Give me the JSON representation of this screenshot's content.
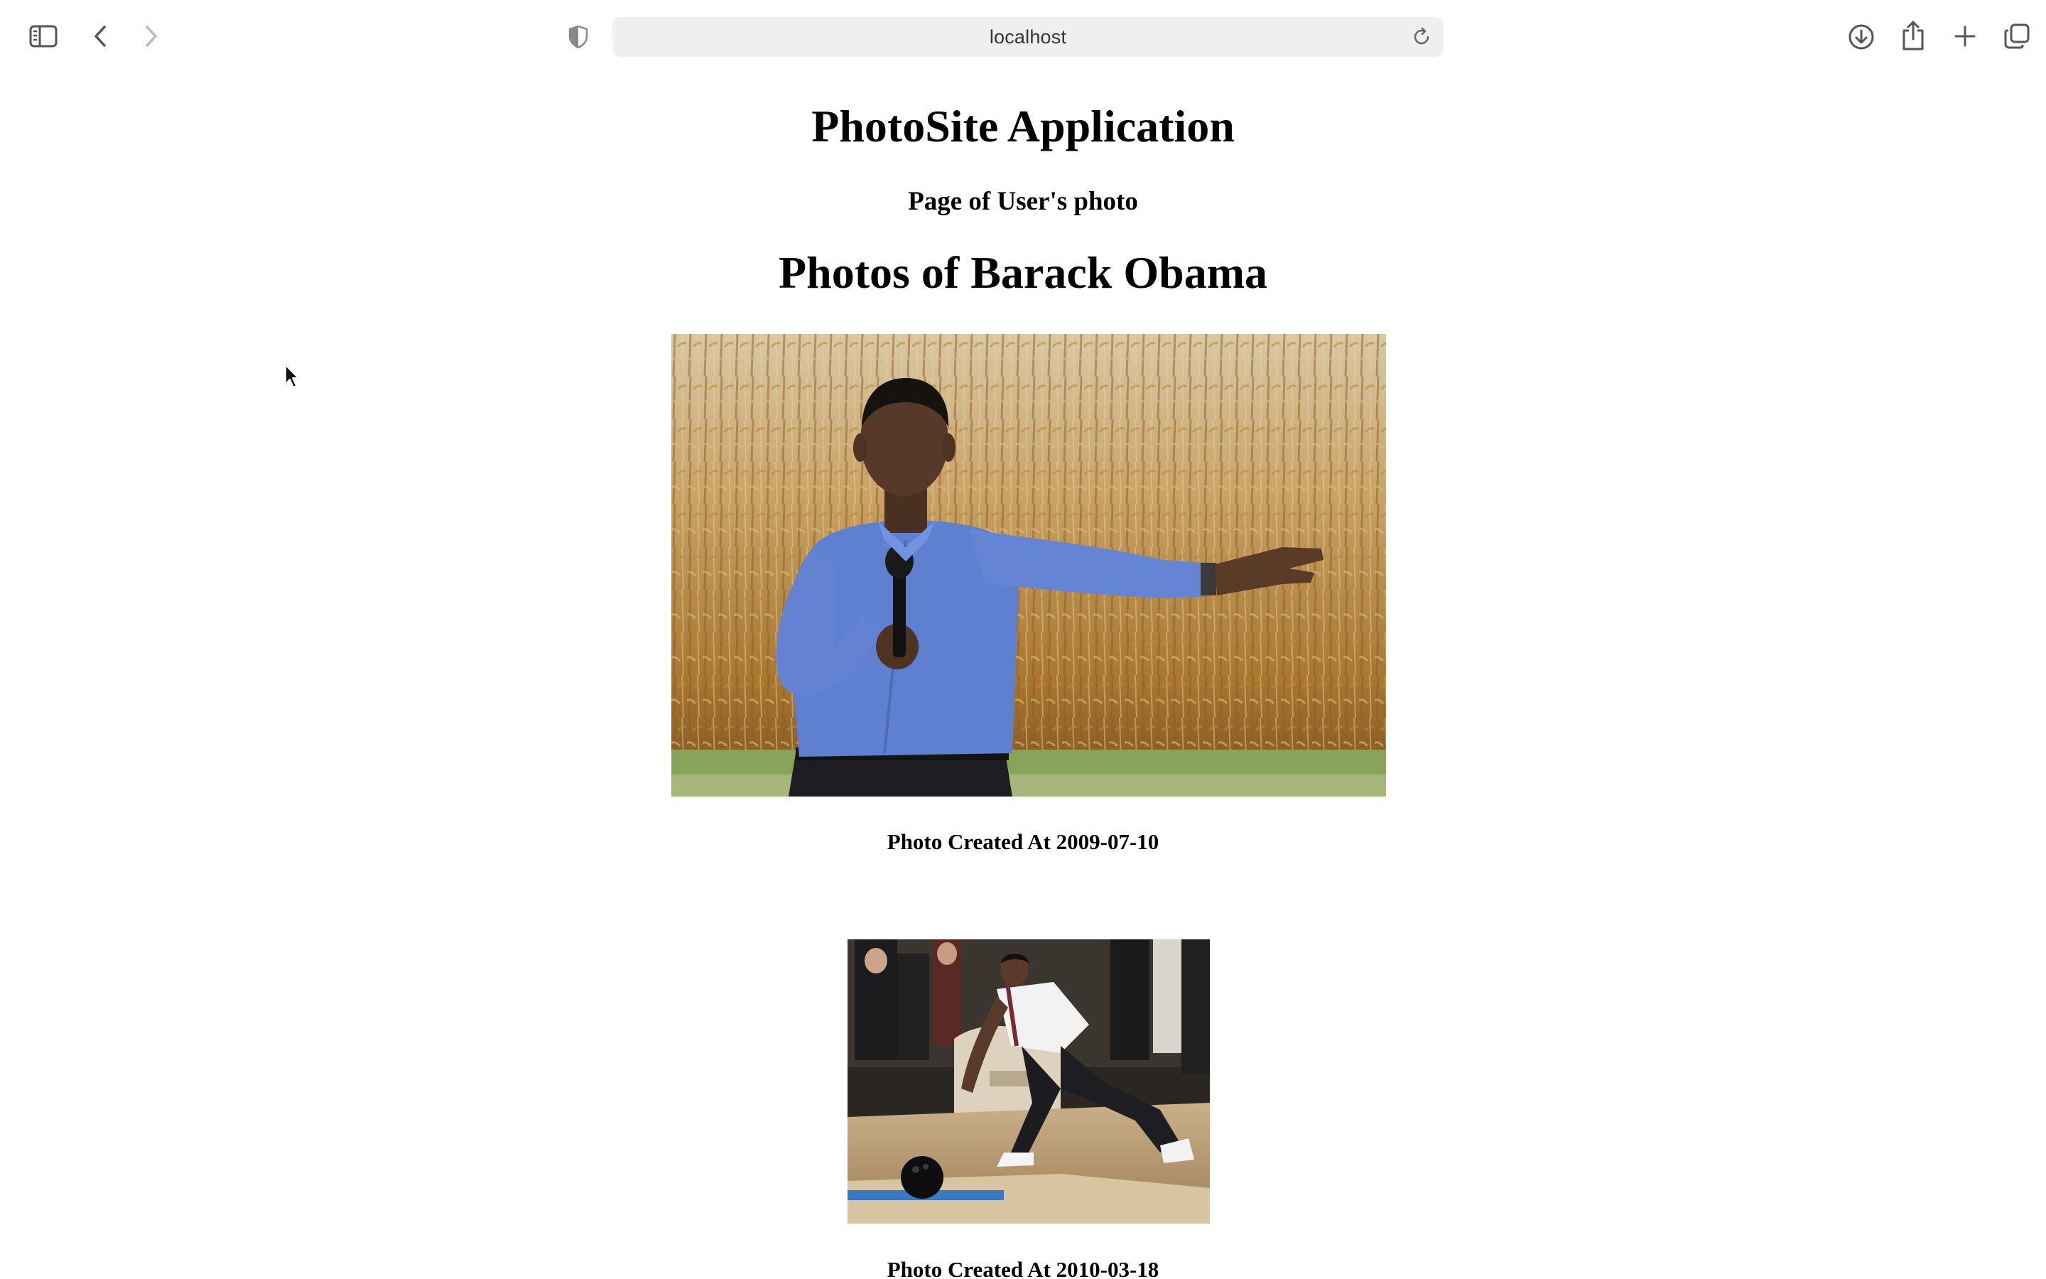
{
  "browser": {
    "url": "localhost",
    "icons": {
      "sidebar": "sidebar-icon",
      "back": "chevron-left-icon",
      "forward": "chevron-right-icon",
      "privacy": "shield-icon",
      "reload": "reload-icon",
      "downloads": "download-icon",
      "share": "share-icon",
      "new_tab": "plus-icon",
      "tabs": "tab-overview-icon"
    }
  },
  "page": {
    "app_title": "PhotoSite Application",
    "subtitle": "Page of User's photo",
    "heading": "Photos of Barack Obama"
  },
  "photos": [
    {
      "subject": "cornfield-speech",
      "caption": "Photo Created At 2009-07-10"
    },
    {
      "subject": "bowling",
      "caption": "Photo Created At 2010-03-18"
    }
  ]
}
